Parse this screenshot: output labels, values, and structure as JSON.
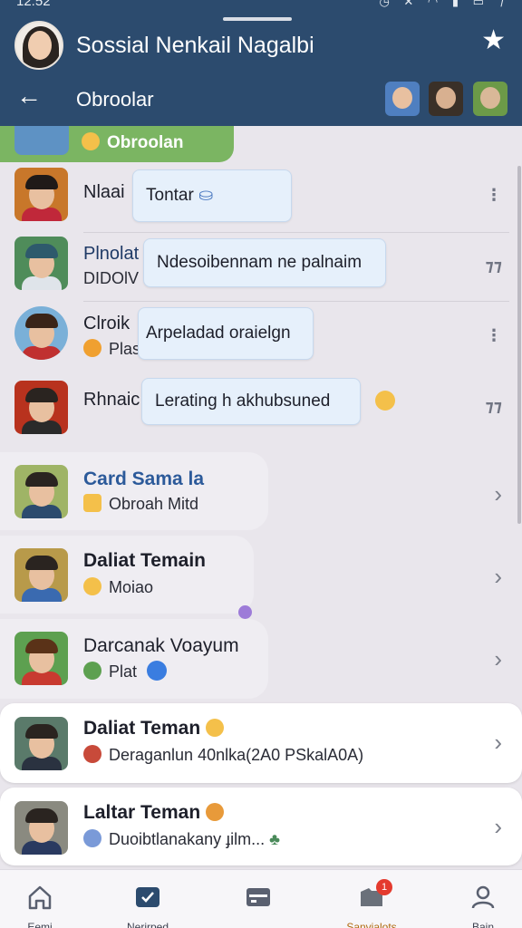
{
  "status_bar": {
    "time": "12:52",
    "icons": "◷ ✕ ◠ ▮ ▭ ⁊"
  },
  "header": {
    "app_title": "Sossial Nenkail Nagalbi",
    "nav_title": "Obroolar",
    "accent_color": "#2c4b6e"
  },
  "tag_row": {
    "label": "Obroolan"
  },
  "rows": [
    {
      "name": "Nlaai",
      "bubble": "Tontar",
      "menu": "⋮"
    },
    {
      "name": "Plnolat",
      "sub": "DIDOlV",
      "bubble": "Ndesoibennam ne palnaim",
      "menu": "⁊⁊"
    },
    {
      "name": "Clroik",
      "sub": "Plaso",
      "bubble": "Arpeladad oraielgn",
      "menu": "⋮"
    },
    {
      "name": "Rhnaic",
      "bubble": "Lerating h akhubsuned",
      "menu": "⁊⁊"
    }
  ],
  "cards": [
    {
      "name": "Card Sama la",
      "sub": "Obroah Mitd"
    },
    {
      "name": "Daliat Temain",
      "sub": "Moiao"
    },
    {
      "name": "Darcanak Voayum",
      "sub": "Plat"
    },
    {
      "name": "Daliat Teman",
      "sub": "Deraganlun 40nlka(2A0 PSkalA0A)"
    },
    {
      "name": "Laltar Teman",
      "sub": "Duoibtlanakany ɟilm..."
    }
  ],
  "bottom_nav": [
    {
      "label": "Eemi",
      "icon": "home-icon"
    },
    {
      "label": "Nerirped",
      "icon": "chat-check-icon"
    },
    {
      "label": "",
      "icon": "card-icon"
    },
    {
      "label": "Sanvialots",
      "icon": "folder-icon",
      "badge": "1"
    },
    {
      "label": "Bain",
      "icon": "person-icon"
    }
  ]
}
